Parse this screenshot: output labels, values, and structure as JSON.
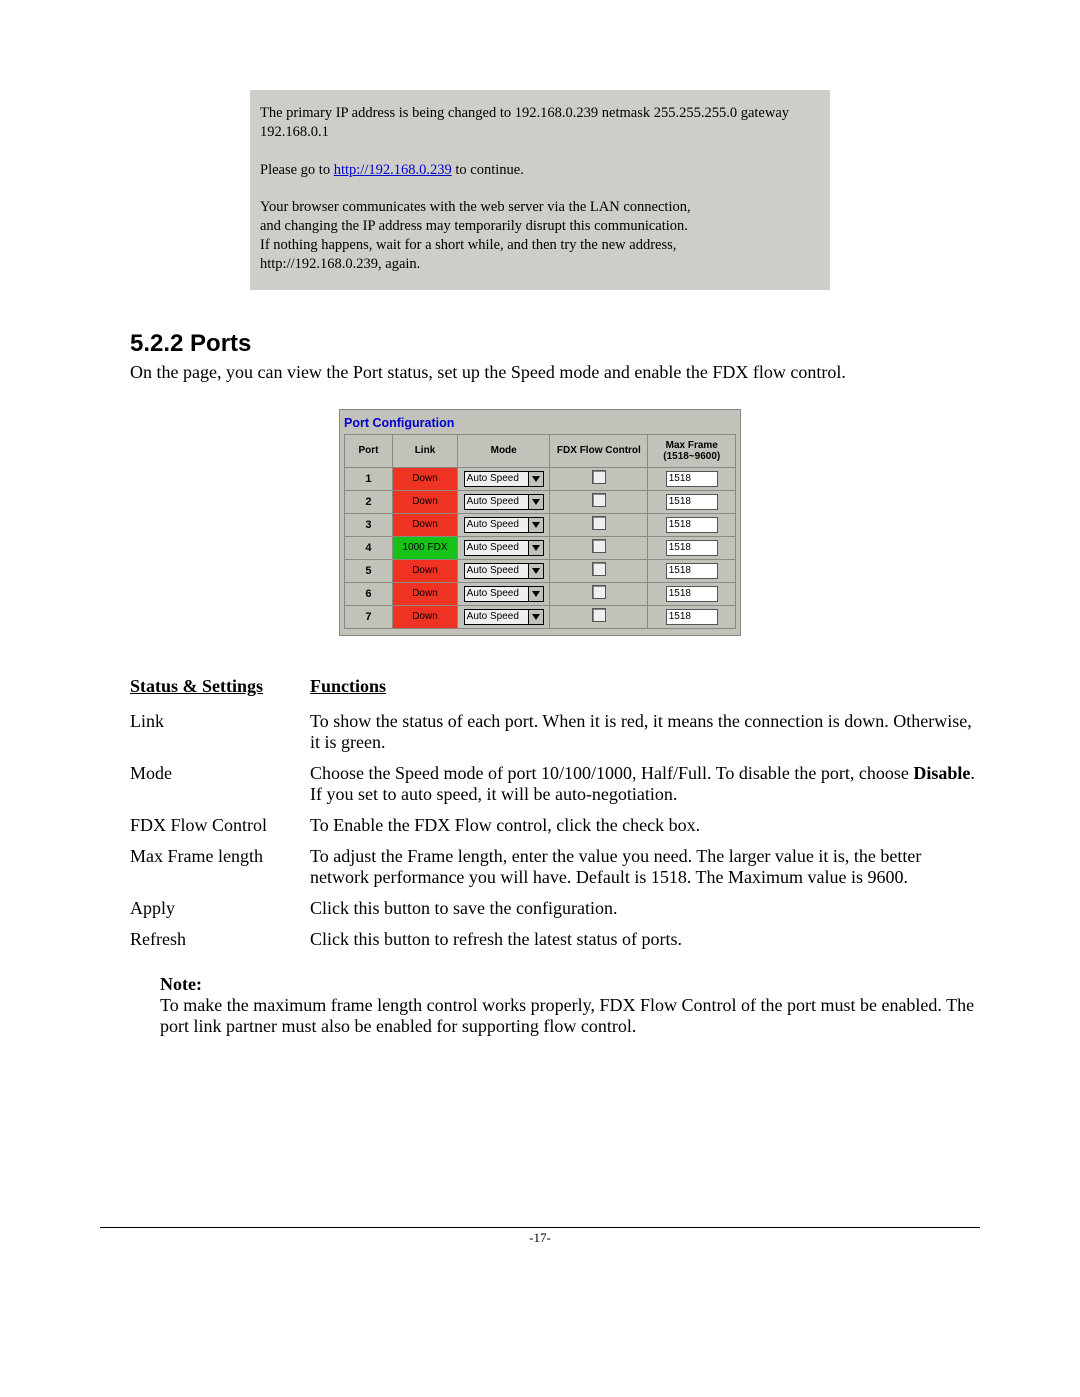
{
  "notice": {
    "line1_prefix": "The primary IP address is being changed to ",
    "ip": "192.168.0.239",
    "line1_mid": " netmask ",
    "netmask": "255.255.255.0",
    "line1_gw_label": " gateway ",
    "gateway": "192.168.0.1",
    "line2_prefix": "Please go to ",
    "link_text": "http://192.168.0.239",
    "line2_suffix": " to continue.",
    "para3_l1": "Your browser communicates with the web server via the LAN connection,",
    "para3_l2": "and changing the IP address may temporarily disrupt this communication.",
    "para3_l3": "If nothing happens, wait for a short while, and then try the new address,",
    "para3_l4": "http://192.168.0.239, again."
  },
  "section": {
    "heading": "5.2.2  Ports",
    "intro": "On the page, you can view the Port status, set up the Speed mode and enable the FDX flow control."
  },
  "portconfig": {
    "title": "Port Configuration",
    "headers": {
      "port": "Port",
      "link": "Link",
      "mode": "Mode",
      "fdx": "FDX Flow Control",
      "max": "Max Frame (1518~9600)"
    },
    "mode_option": "Auto Speed",
    "rows": [
      {
        "port": "1",
        "link": "Down",
        "link_state": "down",
        "maxframe": "1518"
      },
      {
        "port": "2",
        "link": "Down",
        "link_state": "down",
        "maxframe": "1518"
      },
      {
        "port": "3",
        "link": "Down",
        "link_state": "down",
        "maxframe": "1518"
      },
      {
        "port": "4",
        "link": "1000 FDX",
        "link_state": "up",
        "maxframe": "1518"
      },
      {
        "port": "5",
        "link": "Down",
        "link_state": "down",
        "maxframe": "1518"
      },
      {
        "port": "6",
        "link": "Down",
        "link_state": "down",
        "maxframe": "1518"
      },
      {
        "port": "7",
        "link": "Down",
        "link_state": "down",
        "maxframe": "1518"
      }
    ]
  },
  "defs": {
    "head_label": "Status  &  Settings",
    "head_func": "Functions",
    "rows": [
      {
        "label": "Link",
        "func": "To show the status of each port. When it is red, it means the connection is down. Otherwise, it is green."
      },
      {
        "label": "Mode",
        "func_pre": "Choose the Speed mode of port 10/100/1000, Half/Full. To disable the port, choose ",
        "func_bold": "Disable",
        "func_post": ". If you set to auto speed, it will be auto-negotiation."
      },
      {
        "label": "FDX Flow Control",
        "func": "To Enable the FDX Flow control, click the check box."
      },
      {
        "label": "Max Frame length",
        "func": "To adjust the Frame length, enter the value you need. The larger value it is, the better network performance you will have. Default is 1518. The Maximum value is 9600."
      },
      {
        "label": "Apply",
        "func": "Click this button to save the configuration."
      },
      {
        "label": "Refresh",
        "func": "Click this button to refresh the latest status of ports."
      }
    ]
  },
  "note": {
    "title": "Note:",
    "body": "To make the maximum frame length control works properly, FDX Flow Control of the port must be enabled. The port link partner must also be enabled for supporting flow control."
  },
  "footer": {
    "page": "-17-"
  }
}
